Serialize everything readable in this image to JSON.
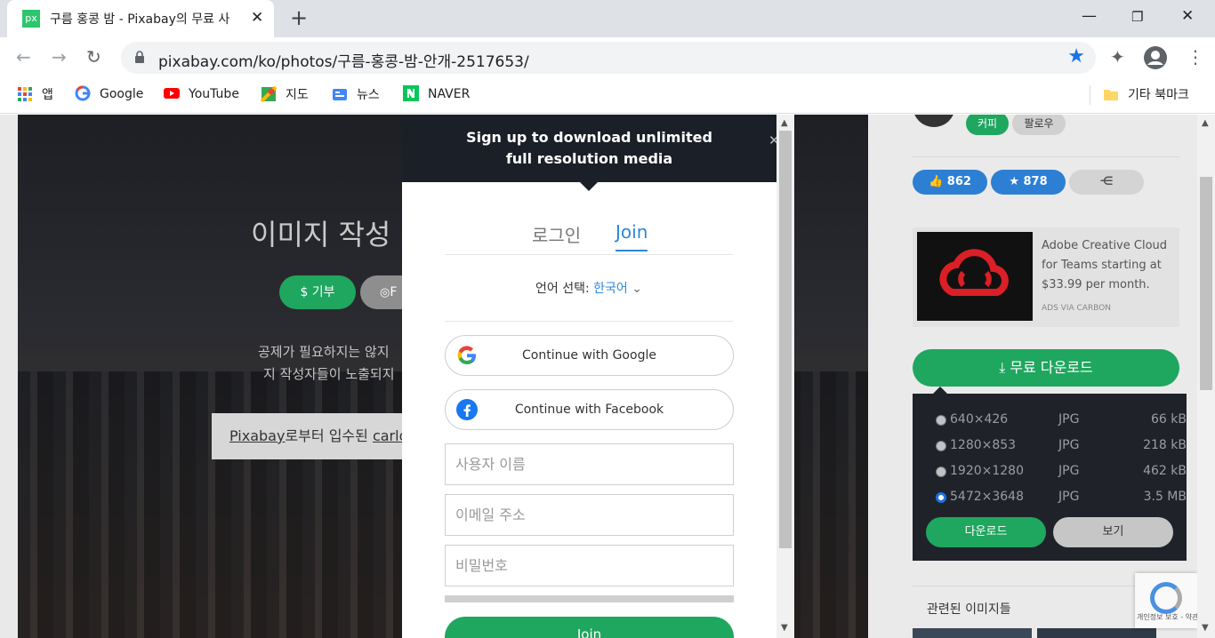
{
  "browser": {
    "tab_title": "구름 홍콩 밤 - Pixabay의 무료 사",
    "favicon_text": "px",
    "url": "pixabay.com/ko/photos/구름-홍콩-밤-안개-2517653/",
    "bookmarks": [
      {
        "label": "앱",
        "icon": "apps-grid-icon"
      },
      {
        "label": "Google",
        "icon": "google-icon"
      },
      {
        "label": "YouTube",
        "icon": "youtube-icon"
      },
      {
        "label": "지도",
        "icon": "maps-icon"
      },
      {
        "label": "뉴스",
        "icon": "news-icon"
      },
      {
        "label": "NAVER",
        "icon": "naver-icon"
      }
    ],
    "other_bookmarks": "기타 북마크"
  },
  "hero": {
    "heading": "이미지 작성",
    "donate": "$ 기부",
    "follow": "F",
    "para1": "공제가 필요하지는 않지",
    "para2": "지 작성자들이 노출되지",
    "credit_link": "Pixabay",
    "credit_mid": "로부터 입수된 ",
    "credit_author": "carlo"
  },
  "sidebar": {
    "pill_coffee": "커피",
    "pill_follow": "팔로우",
    "likes": "862",
    "favorites": "878",
    "ad_text": "Adobe Creative Cloud for Teams starting at $33.99 per month.",
    "ad_source": "ADS VIA CARBON",
    "download_label": "무료 다운로드",
    "download_options": [
      {
        "res": "640×426",
        "fmt": "JPG",
        "size": "66 kB",
        "selected": false
      },
      {
        "res": "1280×853",
        "fmt": "JPG",
        "size": "218 kB",
        "selected": false
      },
      {
        "res": "1920×1280",
        "fmt": "JPG",
        "size": "462 kB",
        "selected": false
      },
      {
        "res": "5472×3648",
        "fmt": "JPG",
        "size": "3.5 MB",
        "selected": true
      }
    ],
    "download_go": "다운로드",
    "view": "보기",
    "related": "관련된 이미지들",
    "recaptcha_text": "개인정보 보호 - 약관"
  },
  "modal": {
    "banner_line1": "Sign up to download unlimited",
    "banner_line2": "full resolution media",
    "tab_login": "로그인",
    "tab_join": "Join",
    "lang_label": "언어 선택: ",
    "lang_value": "한국어",
    "google_btn": "Continue with Google",
    "facebook_btn": "Continue with Facebook",
    "username_placeholder": "사용자 이름",
    "email_placeholder": "이메일 주소",
    "password_placeholder": "비밀번호",
    "join_btn": "Join"
  }
}
